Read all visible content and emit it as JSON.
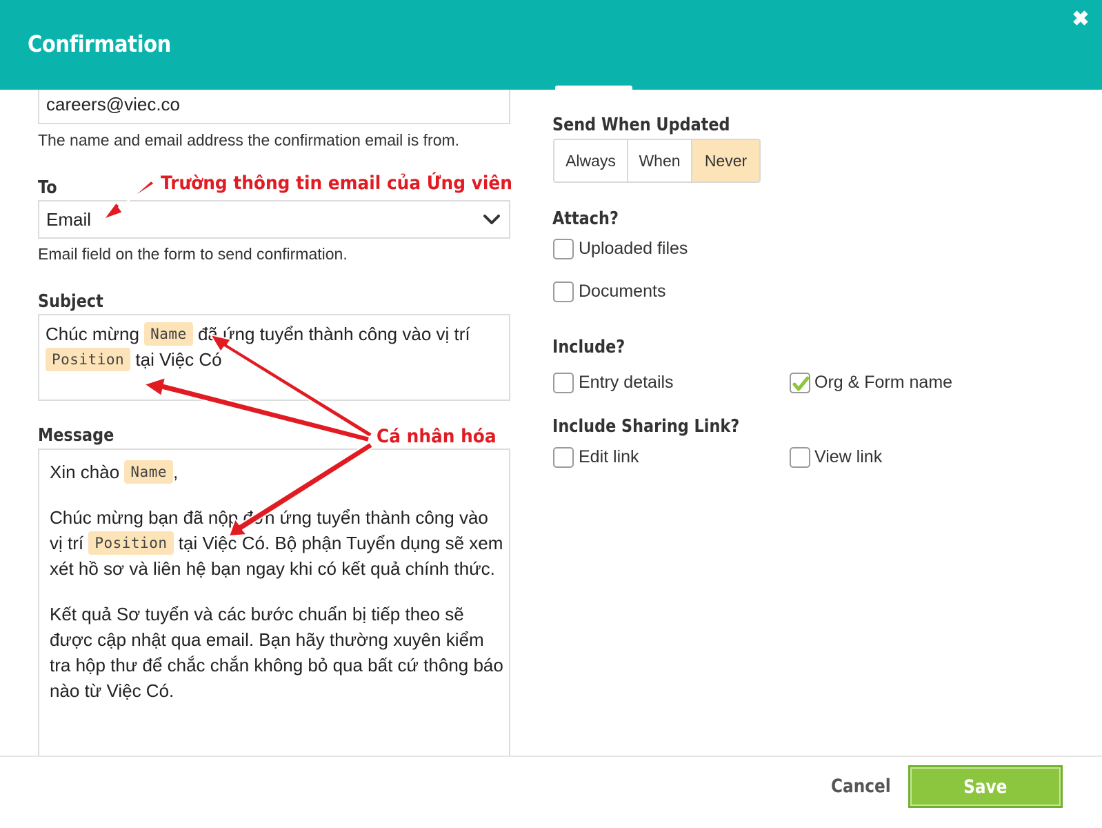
{
  "header": {
    "title": "Confirmation",
    "close_glyph": "✖",
    "close_icon": "close-icon"
  },
  "left": {
    "from_value": "careers@viec.co",
    "from_help": "The name and email address the confirmation email is from.",
    "to_label": "To",
    "to_value": "Email",
    "to_help": "Email field on the form to send confirmation.",
    "subject_label": "Subject",
    "subject": {
      "part1": "Chúc mừng ",
      "tag1": "Name",
      "part2": " đã ứng tuyển thành công vào vị trí ",
      "tag2": "Position",
      "part3": " tại Việc Có"
    },
    "message_label": "Message",
    "message": {
      "p1_a": "Xin chào ",
      "p1_tag": "Name",
      "p1_b": ",",
      "p2_a": "Chúc mừng bạn đã nộp đơn ứng tuyển thành công vào vị trí ",
      "p2_tag": "Position",
      "p2_b": " tại Việc Có. Bộ phận Tuyển dụng sẽ xem xét hồ sơ và liên hệ bạn ngay khi có kết quả chính thức.",
      "p3": "Kết quả Sơ tuyển và các bước chuẩn bị tiếp theo sẽ được cập nhật qua email. Bạn hãy thường xuyên kiểm tra hộp thư để chắc chắn không bỏ qua bất cứ thông báo nào từ Việc Có."
    }
  },
  "right": {
    "send_when_updated_label": "Send When Updated",
    "send_options": [
      "Always",
      "When",
      "Never"
    ],
    "send_selected": "Never",
    "attach_label": "Attach?",
    "attach_uploaded": "Uploaded files",
    "attach_documents": "Documents",
    "include_label": "Include?",
    "include_entry": "Entry details",
    "include_org": "Org & Form name",
    "include_org_checked": true,
    "sharing_label": "Include Sharing Link?",
    "sharing_edit": "Edit link",
    "sharing_view": "View link"
  },
  "annotations": {
    "to_note": "Trường thông tin email của Ứng viên",
    "personalize_note": "Cá nhân hóa",
    "color": "#e11b22"
  },
  "footer": {
    "cancel_label": "Cancel",
    "save_label": "Save",
    "save_color": "#8cc63f"
  },
  "colors": {
    "header": "#0bb3ad",
    "tag_bg": "#fde3b8"
  }
}
